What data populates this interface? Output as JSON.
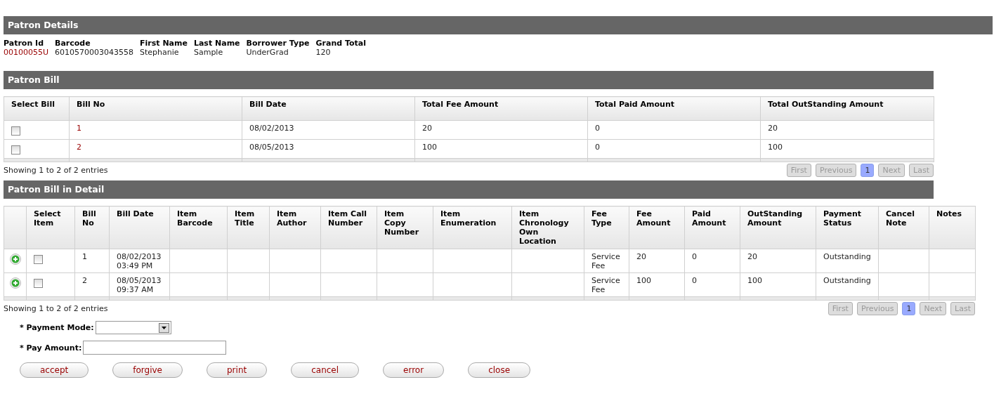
{
  "patron_details": {
    "title": "Patron Details",
    "fields": [
      {
        "label": "Patron Id",
        "value": "00100055U",
        "kind": "link"
      },
      {
        "label": "Barcode",
        "value": "6010570003043558",
        "kind": "plain"
      },
      {
        "label": "First Name",
        "value": "Stephanie",
        "kind": "plain"
      },
      {
        "label": "Last Name",
        "value": "Sample",
        "kind": "plain"
      },
      {
        "label": "Borrower Type",
        "value": "UnderGrad",
        "kind": "plain"
      },
      {
        "label": "Grand Total",
        "value": "120",
        "kind": "plain"
      }
    ]
  },
  "patron_bill": {
    "title": "Patron Bill",
    "columns": [
      {
        "label": "Select Bill",
        "kind": "check"
      },
      {
        "label": "Bill No",
        "kind": "link"
      },
      {
        "label": "Bill Date",
        "kind": "plain"
      },
      {
        "label": "Total Fee Amount",
        "kind": "plain"
      },
      {
        "label": "Total Paid Amount",
        "kind": "plain"
      },
      {
        "label": "Total OutStanding Amount",
        "kind": "plain"
      }
    ],
    "rows": [
      {
        "checked": false,
        "cells": [
          "",
          "1",
          "08/02/2013",
          "20",
          "0",
          "20"
        ]
      },
      {
        "checked": false,
        "cells": [
          "",
          "2",
          "08/05/2013",
          "100",
          "0",
          "100"
        ]
      }
    ],
    "info": "Showing 1 to 2 of 2 entries",
    "pager": [
      {
        "label": "First",
        "selected": false,
        "disabled": true
      },
      {
        "label": "Previous",
        "selected": false,
        "disabled": true
      },
      {
        "label": "1",
        "selected": true,
        "disabled": false
      },
      {
        "label": "Next",
        "selected": false,
        "disabled": true
      },
      {
        "label": "Last",
        "selected": false,
        "disabled": true
      }
    ]
  },
  "bill_detail": {
    "title": "Patron Bill in Detail",
    "columns": [
      {
        "kind": "expand"
      },
      {
        "label": "Select Item",
        "kind": "check"
      },
      {
        "label": "Bill No",
        "kind": "plain"
      },
      {
        "label": "Bill Date",
        "kind": "plain"
      },
      {
        "label": "Item Barcode",
        "kind": "plain"
      },
      {
        "label": "Item Title",
        "kind": "plain"
      },
      {
        "label": "Item Author",
        "kind": "plain"
      },
      {
        "label": "Item Call Number",
        "kind": "plain"
      },
      {
        "label": "Item Copy Number",
        "kind": "plain"
      },
      {
        "label": "Item Enumeration",
        "kind": "plain"
      },
      {
        "label": "Item Chronology Own Location",
        "kind": "plain"
      },
      {
        "label": "Fee Type",
        "kind": "plain"
      },
      {
        "label": "Fee Amount",
        "kind": "plain"
      },
      {
        "label": "Paid Amount",
        "kind": "plain"
      },
      {
        "label": "OutStanding Amount",
        "kind": "plain"
      },
      {
        "label": "Payment Status",
        "kind": "plain"
      },
      {
        "label": "Cancel Note",
        "kind": "plain"
      },
      {
        "label": "Notes",
        "kind": "plain"
      }
    ],
    "rows": [
      {
        "expanded": false,
        "checked": false,
        "cells": [
          "",
          "",
          "1",
          "08/02/2013 03:49 PM",
          "",
          "",
          "",
          "",
          "",
          "",
          "",
          "Service Fee",
          "20",
          "0",
          "20",
          "Outstanding",
          "",
          ""
        ]
      },
      {
        "expanded": false,
        "checked": false,
        "cells": [
          "",
          "",
          "2",
          "08/05/2013 09:37 AM",
          "",
          "",
          "",
          "",
          "",
          "",
          "",
          "Service Fee",
          "100",
          "0",
          "100",
          "Outstanding",
          "",
          ""
        ]
      }
    ],
    "info": "Showing 1 to 2 of 2 entries",
    "pager": [
      {
        "label": "First",
        "selected": false,
        "disabled": true
      },
      {
        "label": "Previous",
        "selected": false,
        "disabled": true
      },
      {
        "label": "1",
        "selected": true,
        "disabled": false
      },
      {
        "label": "Next",
        "selected": false,
        "disabled": true
      },
      {
        "label": "Last",
        "selected": false,
        "disabled": true
      }
    ]
  },
  "payment_mode": {
    "label": "* Payment Mode:"
  },
  "pay_amount": {
    "label": "* Pay Amount:"
  },
  "buttons": [
    "accept",
    "forgive",
    "print",
    "cancel",
    "error",
    "close"
  ]
}
